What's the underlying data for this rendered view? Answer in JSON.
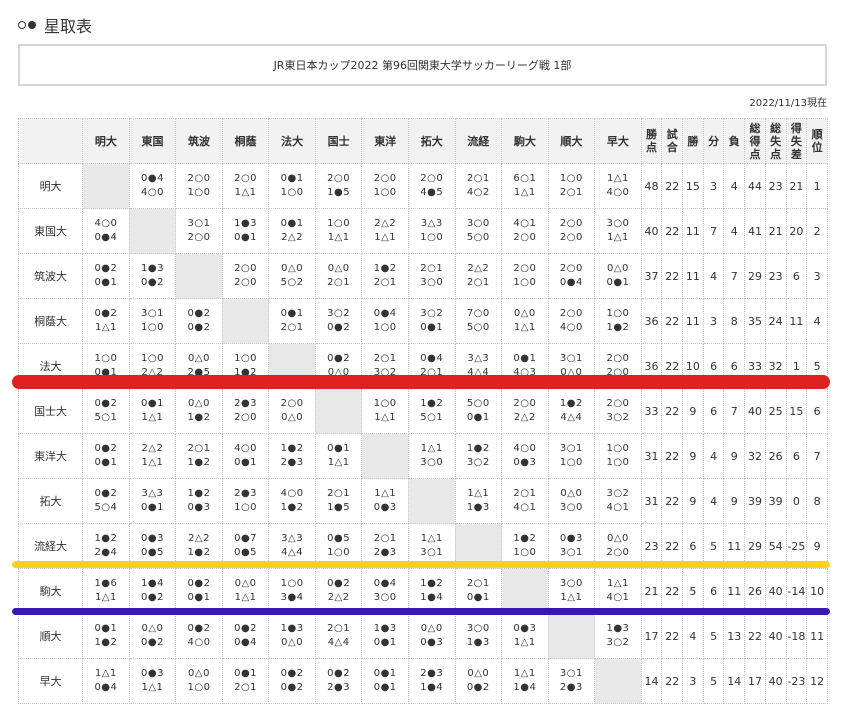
{
  "header": {
    "title": "星取表"
  },
  "competition": {
    "name": "JR東日本カップ2022 第96回関東大学サッカーリーグ戦 1部"
  },
  "date_stamp": "2022/11/13現在",
  "columns": {
    "opponents": [
      "明大",
      "東国",
      "筑波",
      "桐蔭",
      "法大",
      "国士",
      "東洋",
      "拓大",
      "流経",
      "駒大",
      "順大",
      "早大"
    ],
    "stats": [
      "勝点",
      "試合",
      "勝",
      "分",
      "負",
      "総得点",
      "総失点",
      "得失差",
      "順位"
    ]
  },
  "rows": [
    {
      "team": "明大",
      "results": [
        null,
        [
          "0●4",
          "4○0"
        ],
        [
          "2○0",
          "1○0"
        ],
        [
          "2○0",
          "1△1"
        ],
        [
          "0●1",
          "1○0"
        ],
        [
          "2○0",
          "1●5"
        ],
        [
          "2○0",
          "1○0"
        ],
        [
          "2○0",
          "4●5"
        ],
        [
          "2○1",
          "4○2"
        ],
        [
          "6○1",
          "1△1"
        ],
        [
          "1○0",
          "2○1"
        ],
        [
          "1△1",
          "4○0"
        ]
      ],
      "stats": [
        "48",
        "22",
        "15",
        "3",
        "4",
        "44",
        "23",
        "21",
        "1"
      ]
    },
    {
      "team": "東国大",
      "results": [
        [
          "4○0",
          "0●4"
        ],
        null,
        [
          "3○1",
          "2○0"
        ],
        [
          "1●3",
          "0●1"
        ],
        [
          "0●1",
          "2△2"
        ],
        [
          "1○0",
          "1△1"
        ],
        [
          "2△2",
          "1△1"
        ],
        [
          "3△3",
          "1○0"
        ],
        [
          "3○0",
          "5○0"
        ],
        [
          "4○1",
          "2○0"
        ],
        [
          "2○0",
          "2○0"
        ],
        [
          "3○0",
          "1△1"
        ]
      ],
      "stats": [
        "40",
        "22",
        "11",
        "7",
        "4",
        "41",
        "21",
        "20",
        "2"
      ]
    },
    {
      "team": "筑波大",
      "results": [
        [
          "0●2",
          "0●1"
        ],
        [
          "1●3",
          "0●2"
        ],
        null,
        [
          "2○0",
          "2○0"
        ],
        [
          "0△0",
          "5○2"
        ],
        [
          "0△0",
          "2○1"
        ],
        [
          "1●2",
          "2○1"
        ],
        [
          "2○1",
          "3○0"
        ],
        [
          "2△2",
          "2○1"
        ],
        [
          "2○0",
          "1○0"
        ],
        [
          "2○0",
          "0●4"
        ],
        [
          "0△0",
          "0●1"
        ]
      ],
      "stats": [
        "37",
        "22",
        "11",
        "4",
        "7",
        "29",
        "23",
        "6",
        "3"
      ]
    },
    {
      "team": "桐蔭大",
      "results": [
        [
          "0●2",
          "1△1"
        ],
        [
          "3○1",
          "1○0"
        ],
        [
          "0●2",
          "0●2"
        ],
        null,
        [
          "0●1",
          "2○1"
        ],
        [
          "3○2",
          "0●2"
        ],
        [
          "0●4",
          "1○0"
        ],
        [
          "3○2",
          "0●1"
        ],
        [
          "7○0",
          "5○0"
        ],
        [
          "0△0",
          "1△1"
        ],
        [
          "2○0",
          "4○0"
        ],
        [
          "1○0",
          "1●2"
        ]
      ],
      "stats": [
        "36",
        "22",
        "11",
        "3",
        "8",
        "35",
        "24",
        "11",
        "4"
      ]
    },
    {
      "team": "法大",
      "results": [
        [
          "1○0",
          "0●1"
        ],
        [
          "1○0",
          "2△2"
        ],
        [
          "0△0",
          "2●5"
        ],
        [
          "1○0",
          "1●2"
        ],
        null,
        [
          "0●2",
          "0△0"
        ],
        [
          "2○1",
          "3○2"
        ],
        [
          "0●4",
          "2○1"
        ],
        [
          "3△3",
          "4△4"
        ],
        [
          "0●1",
          "4○3"
        ],
        [
          "3○1",
          "0△0"
        ],
        [
          "2○0",
          "2○0"
        ]
      ],
      "stats": [
        "36",
        "22",
        "10",
        "6",
        "6",
        "33",
        "32",
        "1",
        "5"
      ]
    },
    {
      "team": "国士大",
      "results": [
        [
          "0●2",
          "5○1"
        ],
        [
          "0●1",
          "1△1"
        ],
        [
          "0△0",
          "1●2"
        ],
        [
          "2●3",
          "2○0"
        ],
        [
          "2○0",
          "0△0"
        ],
        null,
        [
          "1○0",
          "1△1"
        ],
        [
          "1●2",
          "5○1"
        ],
        [
          "5○0",
          "0●1"
        ],
        [
          "2○0",
          "2△2"
        ],
        [
          "1●2",
          "4△4"
        ],
        [
          "2○0",
          "3○2"
        ]
      ],
      "stats": [
        "33",
        "22",
        "9",
        "6",
        "7",
        "40",
        "25",
        "15",
        "6"
      ]
    },
    {
      "team": "東洋大",
      "results": [
        [
          "0●2",
          "0●1"
        ],
        [
          "2△2",
          "1△1"
        ],
        [
          "2○1",
          "1●2"
        ],
        [
          "4○0",
          "0●1"
        ],
        [
          "1●2",
          "2●3"
        ],
        [
          "0●1",
          "1△1"
        ],
        null,
        [
          "1△1",
          "3○0"
        ],
        [
          "1●2",
          "3○2"
        ],
        [
          "4○0",
          "0●3"
        ],
        [
          "3○1",
          "1○0"
        ],
        [
          "1○0",
          "1○0"
        ]
      ],
      "stats": [
        "31",
        "22",
        "9",
        "4",
        "9",
        "32",
        "26",
        "6",
        "7"
      ]
    },
    {
      "team": "拓大",
      "results": [
        [
          "0●2",
          "5○4"
        ],
        [
          "3△3",
          "0●1"
        ],
        [
          "1●2",
          "0●3"
        ],
        [
          "2●3",
          "1○0"
        ],
        [
          "4○0",
          "1●2"
        ],
        [
          "2○1",
          "1●5"
        ],
        [
          "1△1",
          "0●3"
        ],
        null,
        [
          "1△1",
          "1●3"
        ],
        [
          "2○1",
          "4○1"
        ],
        [
          "0△0",
          "3○0"
        ],
        [
          "3○2",
          "4○1"
        ]
      ],
      "stats": [
        "31",
        "22",
        "9",
        "4",
        "9",
        "39",
        "39",
        "0",
        "8"
      ]
    },
    {
      "team": "流経大",
      "results": [
        [
          "1●2",
          "2●4"
        ],
        [
          "0●3",
          "0●5"
        ],
        [
          "2△2",
          "1●2"
        ],
        [
          "0●7",
          "0●5"
        ],
        [
          "3△3",
          "4△4"
        ],
        [
          "0●5",
          "1○0"
        ],
        [
          "2○1",
          "2●3"
        ],
        [
          "1△1",
          "3○1"
        ],
        null,
        [
          "1●2",
          "1○0"
        ],
        [
          "0●3",
          "3○1"
        ],
        [
          "0△0",
          "2○0"
        ]
      ],
      "stats": [
        "23",
        "22",
        "6",
        "5",
        "11",
        "29",
        "54",
        "-25",
        "9"
      ]
    },
    {
      "team": "駒大",
      "results": [
        [
          "1●6",
          "1△1"
        ],
        [
          "1●4",
          "0●2"
        ],
        [
          "0●2",
          "0●1"
        ],
        [
          "0△0",
          "1△1"
        ],
        [
          "1○0",
          "3●4"
        ],
        [
          "0●2",
          "2△2"
        ],
        [
          "0●4",
          "3○0"
        ],
        [
          "1●2",
          "1●4"
        ],
        [
          "2○1",
          "0●1"
        ],
        null,
        [
          "3○0",
          "1△1"
        ],
        [
          "1△1",
          "4○1"
        ]
      ],
      "stats": [
        "21",
        "22",
        "5",
        "6",
        "11",
        "26",
        "40",
        "-14",
        "10"
      ]
    },
    {
      "team": "順大",
      "results": [
        [
          "0●1",
          "1●2"
        ],
        [
          "0△0",
          "0●2"
        ],
        [
          "0●2",
          "4○0"
        ],
        [
          "0●2",
          "0●4"
        ],
        [
          "1●3",
          "0△0"
        ],
        [
          "2○1",
          "4△4"
        ],
        [
          "1●3",
          "0●1"
        ],
        [
          "0△0",
          "0●3"
        ],
        [
          "3○0",
          "1●3"
        ],
        [
          "0●3",
          "1△1"
        ],
        null,
        [
          "1●3",
          "3○2"
        ]
      ],
      "stats": [
        "17",
        "22",
        "4",
        "5",
        "13",
        "22",
        "40",
        "-18",
        "11"
      ]
    },
    {
      "team": "早大",
      "results": [
        [
          "1△1",
          "0●4"
        ],
        [
          "0●3",
          "1△1"
        ],
        [
          "0△0",
          "1○0"
        ],
        [
          "0●1",
          "2○1"
        ],
        [
          "0●2",
          "0●2"
        ],
        [
          "0●2",
          "2●3"
        ],
        [
          "0●1",
          "0●1"
        ],
        [
          "2●3",
          "1●4"
        ],
        [
          "0△0",
          "0●2"
        ],
        [
          "1△1",
          "1●4"
        ],
        [
          "3○1",
          "2●3"
        ],
        null
      ],
      "stats": [
        "14",
        "22",
        "3",
        "5",
        "14",
        "17",
        "40",
        "-23",
        "12"
      ]
    }
  ],
  "colors": {
    "relegation_line": "#e02020",
    "playoff_line": "#ffd21a",
    "promotion_line": "#3a16b8"
  }
}
